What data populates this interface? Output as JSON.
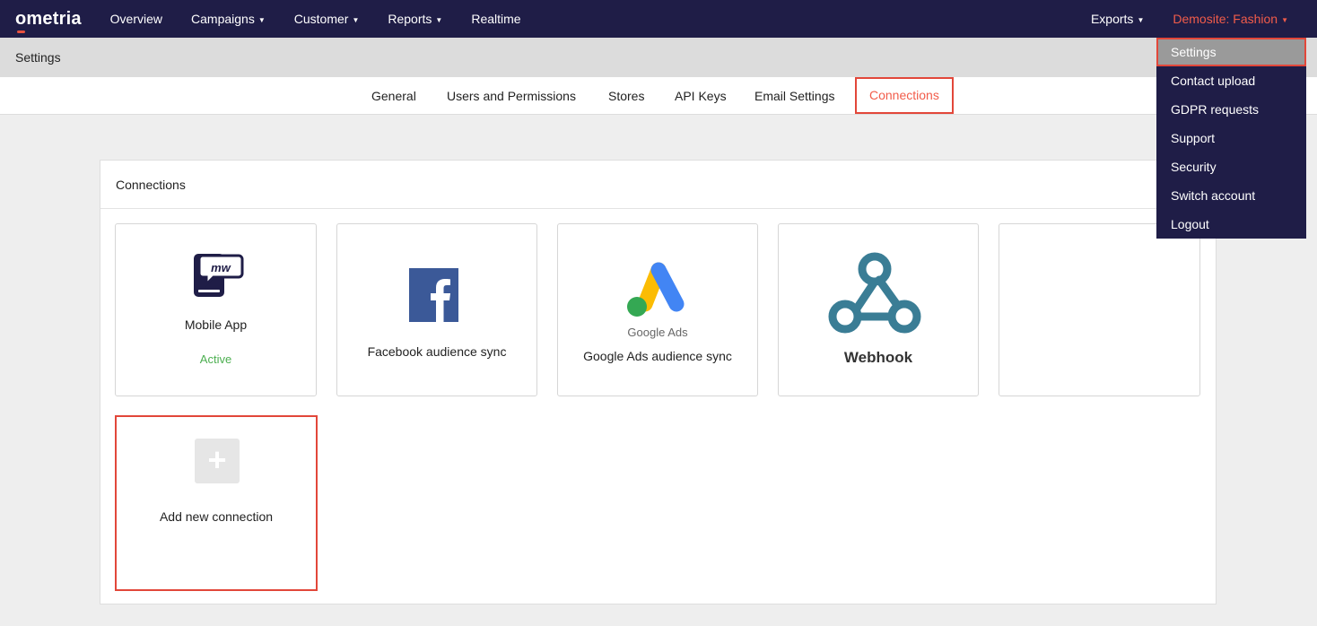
{
  "nav": {
    "logo": "ometria",
    "items": [
      {
        "label": "Overview",
        "caret": false
      },
      {
        "label": "Campaigns",
        "caret": true
      },
      {
        "label": "Customer",
        "caret": true
      },
      {
        "label": "Reports",
        "caret": true
      },
      {
        "label": "Realtime",
        "caret": false
      }
    ],
    "exports": "Exports",
    "account": "Demosite: Fashion",
    "accent_color": "#f25c4a",
    "bg_color": "#1f1d47"
  },
  "settings_bar": {
    "title": "Settings"
  },
  "tabs": [
    {
      "label": "General",
      "active": false
    },
    {
      "label": "Users and Permissions",
      "active": false
    },
    {
      "label": "Stores",
      "active": false
    },
    {
      "label": "API Keys",
      "active": false
    },
    {
      "label": "Email Settings",
      "active": false
    },
    {
      "label": "Connections",
      "active": true
    }
  ],
  "panel": {
    "title": "Connections",
    "cards": [
      {
        "label": "Mobile App",
        "status": "Active",
        "icon": "mobile-app-icon"
      },
      {
        "label": "Facebook audience sync",
        "icon": "facebook-icon"
      },
      {
        "label": "Google Ads audience sync",
        "logo_text": "Google Ads",
        "icon": "google-ads-icon"
      },
      {
        "label": "Webhook",
        "icon": "webhook-icon"
      },
      {
        "label": "",
        "icon": ""
      }
    ],
    "add_card": {
      "label": "Add new connection",
      "icon": "plus-icon"
    }
  },
  "dropdown": {
    "items": [
      {
        "label": "Settings",
        "selected": true
      },
      {
        "label": "Contact upload"
      },
      {
        "label": "GDPR requests"
      },
      {
        "label": "Support"
      },
      {
        "label": "Security"
      },
      {
        "label": "Switch account"
      },
      {
        "label": "Logout"
      }
    ]
  }
}
